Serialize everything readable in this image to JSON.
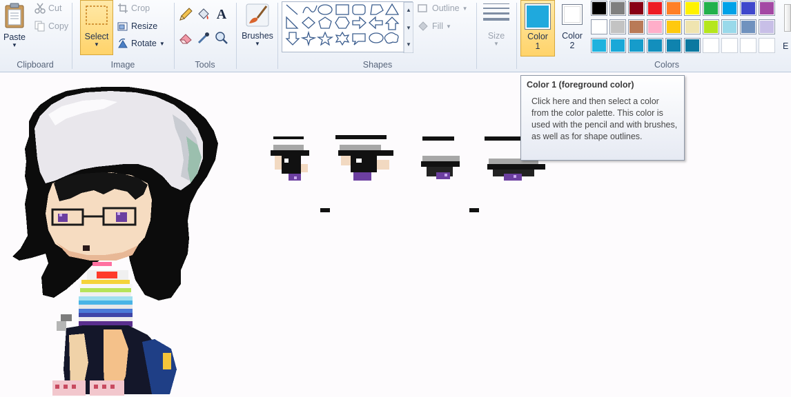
{
  "clipboard": {
    "paste_label": "Paste",
    "cut_label": "Cut",
    "copy_label": "Copy",
    "group_label": "Clipboard"
  },
  "image": {
    "select_label": "Select",
    "crop_label": "Crop",
    "resize_label": "Resize",
    "rotate_label": "Rotate",
    "group_label": "Image"
  },
  "tools": {
    "group_label": "Tools",
    "text_tool_glyph": "A",
    "items": [
      "pencil-icon",
      "fill-bucket-icon",
      "text-icon",
      "eraser-icon",
      "color-picker-icon",
      "magnifier-icon"
    ]
  },
  "brushes": {
    "label": "Brushes"
  },
  "shapes": {
    "group_label": "Shapes",
    "outline_label": "Outline",
    "fill_label": "Fill",
    "size_label": "Size"
  },
  "colors": {
    "group_label": "Colors",
    "color1_label": "Color",
    "color1_number": "1",
    "color2_label": "Color",
    "color2_number": "2",
    "color1_value": "#1fa9dd",
    "color2_value": "#ffffff",
    "edit_colors_cut_label": "E",
    "row1": [
      "#000000",
      "#7f7f7f",
      "#880015",
      "#ed1c24",
      "#ff7f27",
      "#fff200",
      "#22b14c",
      "#00a2e8",
      "#3f48cc",
      "#a349a4"
    ],
    "row2": [
      "#ffffff",
      "#c3c3c3",
      "#b97a57",
      "#ffaec9",
      "#ffc90e",
      "#efe4b0",
      "#b5e61d",
      "#99d9ea",
      "#7092be",
      "#c8bfe7"
    ],
    "row3": [
      "#1fb2de",
      "#1aa8d8",
      "#169ccb",
      "#138fbd",
      "#0f83ae",
      "#0c78a0",
      "",
      "",
      "",
      ""
    ]
  },
  "tooltip": {
    "title": "Color 1 (foreground color)",
    "body": "Click here and then select a color from the color palette. This color is used with the pencil  and with brushes, as well as for shape outlines."
  }
}
